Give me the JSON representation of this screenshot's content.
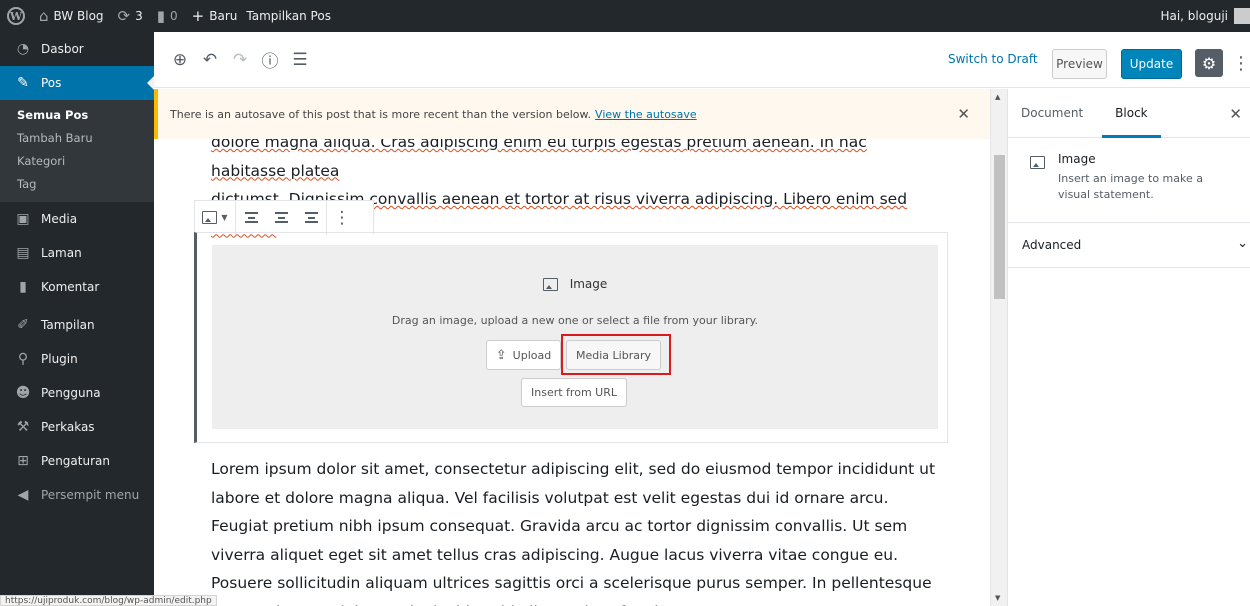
{
  "adminbar": {
    "site_name": "BW Blog",
    "updates_count": "3",
    "comments_count": "0",
    "new_label": "Baru",
    "view_post": "Tampilkan Pos",
    "greeting": "Hai, bloguji"
  },
  "sidebar": {
    "dashboard": "Dasbor",
    "posts": "Pos",
    "submenu": [
      "Semua Pos",
      "Tambah Baru",
      "Kategori",
      "Tag"
    ],
    "media": "Media",
    "pages": "Laman",
    "comments": "Komentar",
    "appearance": "Tampilan",
    "plugins": "Plugin",
    "users": "Pengguna",
    "tools": "Perkakas",
    "settings": "Pengaturan",
    "collapse": "Persempit menu"
  },
  "header": {
    "switch_draft": "Switch to Draft",
    "preview": "Preview",
    "update": "Update"
  },
  "notice": {
    "text": "There is an autosave of this post that is more recent than the version below.",
    "link": "View the autosave"
  },
  "content": {
    "para1_line1": "dolore magna aliqua. Cras adipiscing enim eu turpis egestas pretium aenean. In hac habitasse platea",
    "para1_line2": "dictumst. Dignissim convallis aenean et tortor at risus viverra adipiscing. Libero enim sed faucibus",
    "para2": "Lorem ipsum dolor sit amet, consectetur adipiscing elit, sed do eiusmod tempor incididunt ut labore et dolore magna aliqua. Vel facilisis volutpat est velit egestas dui id ornare arcu. Feugiat pretium nibh ipsum consequat. Gravida arcu ac tortor dignissim convallis. Ut sem viverra aliquet eget sit amet tellus cras adipiscing. Augue lacus viverra vitae congue eu. Posuere sollicitudin aliquam ultrices sagittis orci a scelerisque purus semper. In pellentesque massa placerat duis. Turpis tincidunt id aliquet risus feugiat."
  },
  "image_block": {
    "label": "Image",
    "instructions": "Drag an image, upload a new one or select a file from your library.",
    "upload": "Upload",
    "media_library": "Media Library",
    "insert_url": "Insert from URL"
  },
  "settings_panel": {
    "tab_document": "Document",
    "tab_block": "Block",
    "block_title": "Image",
    "block_description": "Insert an image to make a visual statement.",
    "advanced": "Advanced"
  },
  "statusbar": {
    "url": "https://ujiproduk.com/blog/wp-admin/edit.php"
  },
  "colors": {
    "admin_bg": "#23282d",
    "accent": "#0073aa",
    "update_button": "#0085ba",
    "notice_border": "#ffb900",
    "highlight": "#d81b1b"
  }
}
